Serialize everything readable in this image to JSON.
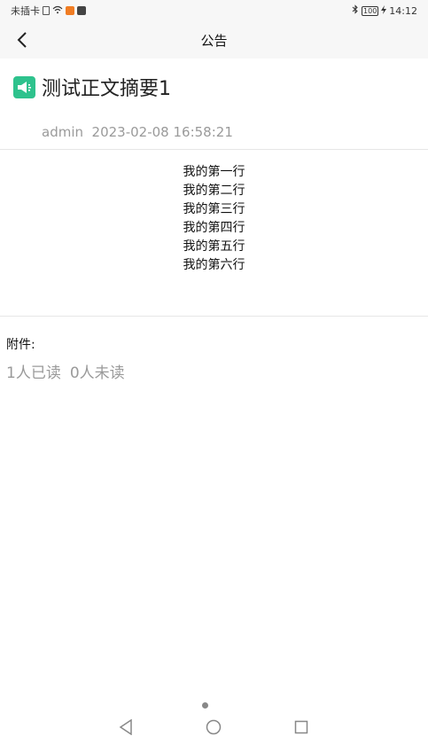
{
  "status_bar": {
    "carrier": "未插卡",
    "battery": "100",
    "time": "14:12"
  },
  "nav": {
    "title": "公告"
  },
  "notice": {
    "title": "测试正文摘要1",
    "author": "admin",
    "datetime": "2023-02-08 16:58:21",
    "body_lines": [
      "我的第一行",
      "我的第二行",
      "我的第三行",
      "我的第四行",
      "我的第五行",
      "我的第六行"
    ],
    "attachments_label": "附件:",
    "read_count": "1人已读",
    "unread_count": "0人未读"
  },
  "colors": {
    "accent": "#2ec28d",
    "muted": "#9a9a9a"
  }
}
